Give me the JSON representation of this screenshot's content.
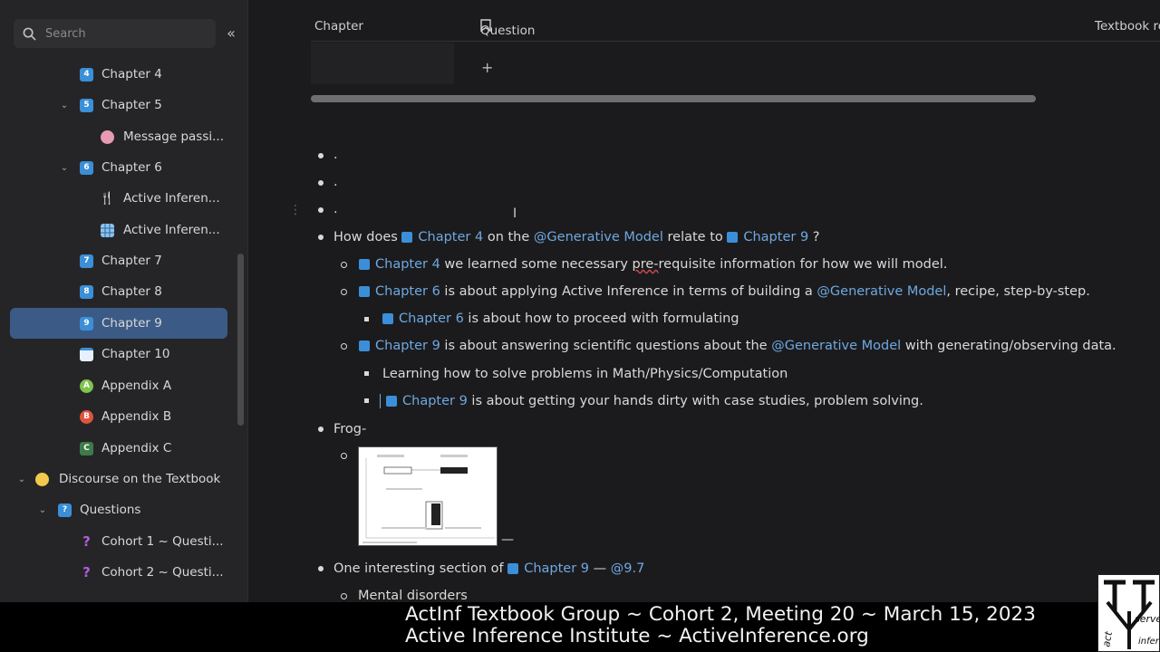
{
  "sidebar": {
    "search_placeholder": "Search",
    "collapse_glyph": "«",
    "items": [
      {
        "label": "Chapter 4",
        "icon": "4",
        "chev": ""
      },
      {
        "label": "Chapter 5",
        "icon": "5",
        "chev": "⌄"
      },
      {
        "label": "Message passi...",
        "icon": "brain-icon",
        "chev": ""
      },
      {
        "label": "Chapter 6",
        "icon": "6",
        "chev": "⌄"
      },
      {
        "label": "Active Inferen...",
        "icon": "fork-knife-icon",
        "chev": ""
      },
      {
        "label": "Active Inferen...",
        "icon": "grid-icon",
        "chev": ""
      },
      {
        "label": "Chapter 7",
        "icon": "7",
        "chev": ""
      },
      {
        "label": "Chapter 8",
        "icon": "8",
        "chev": ""
      },
      {
        "label": "Chapter 9",
        "icon": "9",
        "chev": ""
      },
      {
        "label": "Chapter 10",
        "icon": "calendar-icon",
        "chev": ""
      },
      {
        "label": "Appendix A",
        "icon": "A",
        "chev": ""
      },
      {
        "label": "Appendix B",
        "icon": "B",
        "chev": ""
      },
      {
        "label": "Appendix C",
        "icon": "C",
        "chev": ""
      },
      {
        "label": "Discourse on the Textbook",
        "icon": "speech-bubbles-icon",
        "chev": "⌄"
      },
      {
        "label": "Questions",
        "icon": "?",
        "chev": "⌄"
      },
      {
        "label": "Cohort 1 ~ Questi...",
        "icon": "question-mark-icon",
        "chev": ""
      },
      {
        "label": "Cohort 2 ~ Questi...",
        "icon": "question-mark-icon",
        "chev": ""
      }
    ],
    "colors": {
      "active_bg": "#3b5a85",
      "icon_blue": "#3a8fd8"
    }
  },
  "table": {
    "col_chapter": "Chapter",
    "col_question": "Question",
    "col_textbook": "Textbook re",
    "add_glyph": "+"
  },
  "content": {
    "dots": [
      ".",
      ".",
      "."
    ],
    "q1": {
      "pre": "How does",
      "ref1": "Chapter 4",
      "mid": "on the",
      "gm": "@Generative Model",
      "mid2": "relate to",
      "ref2": "Chapter 9",
      "end": "?"
    },
    "a1": {
      "ref": "Chapter 4",
      "text_a": "we learned some necessary",
      "spell": "pre-",
      "text_b": "requisite information for how we will model."
    },
    "a2": {
      "ref": "Chapter 6",
      "text": "is about applying Active Inference in terms of building a",
      "gm": "@Generative Model",
      "end": ", recipe, step-by-step."
    },
    "a2s": {
      "ref": "Chapter 6",
      "text": " is about how to proceed with formulating"
    },
    "a3": {
      "ref": "Chapter 9",
      "text": "is about answering scientific questions about the",
      "gm": "@Generative Model",
      "end": "with generating/observing data."
    },
    "a3s1": {
      "text": "Learning how to solve problems in Math/Physics/Computation"
    },
    "a3s2": {
      "ref": "Chapter 9",
      "text": "is about getting your hands dirty with case studies, problem solving."
    },
    "frog": "Frog-",
    "dash": "—",
    "section": {
      "pre": "One interesting section of",
      "ref": "Chapter 9",
      "sep": "—",
      "tag": "@9.7"
    },
    "mental": "Mental disorders"
  },
  "caption": {
    "line1": "ActInf Textbook Group ~ Cohort 2, Meeting 20 ~ March 15, 2023",
    "line2": "Active Inference Institute ~ ActiveInference.org"
  },
  "logo": {
    "words": [
      "act",
      "infer",
      "serve"
    ]
  }
}
